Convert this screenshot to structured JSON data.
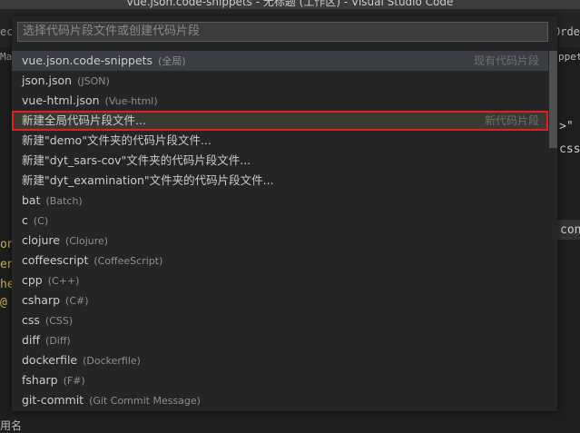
{
  "window": {
    "title": "vue.json.code-snippets - 无标题 (工作区) - Visual Studio Code"
  },
  "background": {
    "tab_left": "ec",
    "tab_right": "Order",
    "crumb_left": "Ma",
    "crumb_right": "ppet",
    "line1": ">\"",
    "line2": "css",
    "line3": "con",
    "bottom_left": "用名"
  },
  "quickpick": {
    "placeholder": "选择代码片段文件或创建代码片段",
    "items": [
      {
        "label": "vue.json.code-snippets",
        "desc": "(全局)",
        "sep": "现有代码片段"
      },
      {
        "label": "json.json",
        "desc": "(JSON)",
        "sep": ""
      },
      {
        "label": "vue-html.json",
        "desc": "(Vue-html)",
        "sep": ""
      },
      {
        "label": "新建全局代码片段文件...",
        "desc": "",
        "sep": "新代码片段"
      },
      {
        "label": "新建\"demo\"文件夹的代码片段文件...",
        "desc": "",
        "sep": ""
      },
      {
        "label": "新建\"dyt_sars-cov\"文件夹的代码片段文件...",
        "desc": "",
        "sep": ""
      },
      {
        "label": "新建\"dyt_examination\"文件夹的代码片段文件...",
        "desc": "",
        "sep": ""
      },
      {
        "label": "bat",
        "desc": "(Batch)",
        "sep": ""
      },
      {
        "label": "c",
        "desc": "(C)",
        "sep": ""
      },
      {
        "label": "clojure",
        "desc": "(Clojure)",
        "sep": ""
      },
      {
        "label": "coffeescript",
        "desc": "(CoffeeScript)",
        "sep": ""
      },
      {
        "label": "cpp",
        "desc": "(C++)",
        "sep": ""
      },
      {
        "label": "csharp",
        "desc": "(C#)",
        "sep": ""
      },
      {
        "label": "css",
        "desc": "(CSS)",
        "sep": ""
      },
      {
        "label": "diff",
        "desc": "(Diff)",
        "sep": ""
      },
      {
        "label": "dockerfile",
        "desc": "(Dockerfile)",
        "sep": ""
      },
      {
        "label": "fsharp",
        "desc": "(F#)",
        "sep": ""
      },
      {
        "label": "git-commit",
        "desc": "(Git Commit Message)",
        "sep": ""
      }
    ]
  }
}
